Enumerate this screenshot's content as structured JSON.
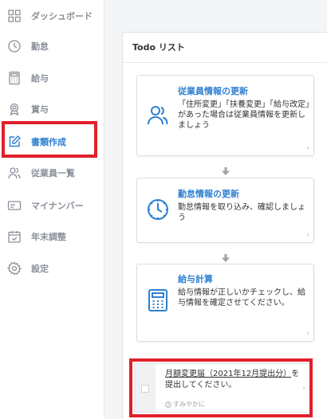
{
  "sidebar": {
    "items": [
      {
        "label": "ダッシュボード",
        "icon": "dashboard-grid-icon"
      },
      {
        "label": "勤怠",
        "icon": "clock-icon"
      },
      {
        "label": "給与",
        "icon": "calculator-icon"
      },
      {
        "label": "賞与",
        "icon": "medal-icon"
      },
      {
        "label": "書類作成",
        "icon": "edit-document-icon"
      },
      {
        "label": "従業員一覧",
        "icon": "people-icon"
      },
      {
        "label": "マイナンバー",
        "icon": "id-card-icon"
      },
      {
        "label": "年末調整",
        "icon": "calendar-check-icon"
      },
      {
        "label": "設定",
        "icon": "gear-icon"
      }
    ],
    "active_index": 4
  },
  "todo": {
    "title": "Todo リスト",
    "cards": [
      {
        "title": "従業員情報の更新",
        "desc": "「住所変更」「扶養変更」「給与改定」があった場合は従業員情報を更新しましょう",
        "icon": "people-icon"
      },
      {
        "title": "勤怠情報の更新",
        "desc": "勤怠情報を取り込み、確認しましょう",
        "icon": "clock-icon"
      },
      {
        "title": "給与計算",
        "desc": "給与情報が正しいかチェックし、給与情報を確定させてください。",
        "icon": "calculator-icon"
      }
    ],
    "task": {
      "link_text": "月額変更届（2021年12月提出分）",
      "rest_text": "を提出してください。",
      "meta": "すみやかに"
    }
  },
  "colors": {
    "accent": "#2e7fd1",
    "highlight": "#e0202a",
    "nav_text": "#8a9099"
  }
}
